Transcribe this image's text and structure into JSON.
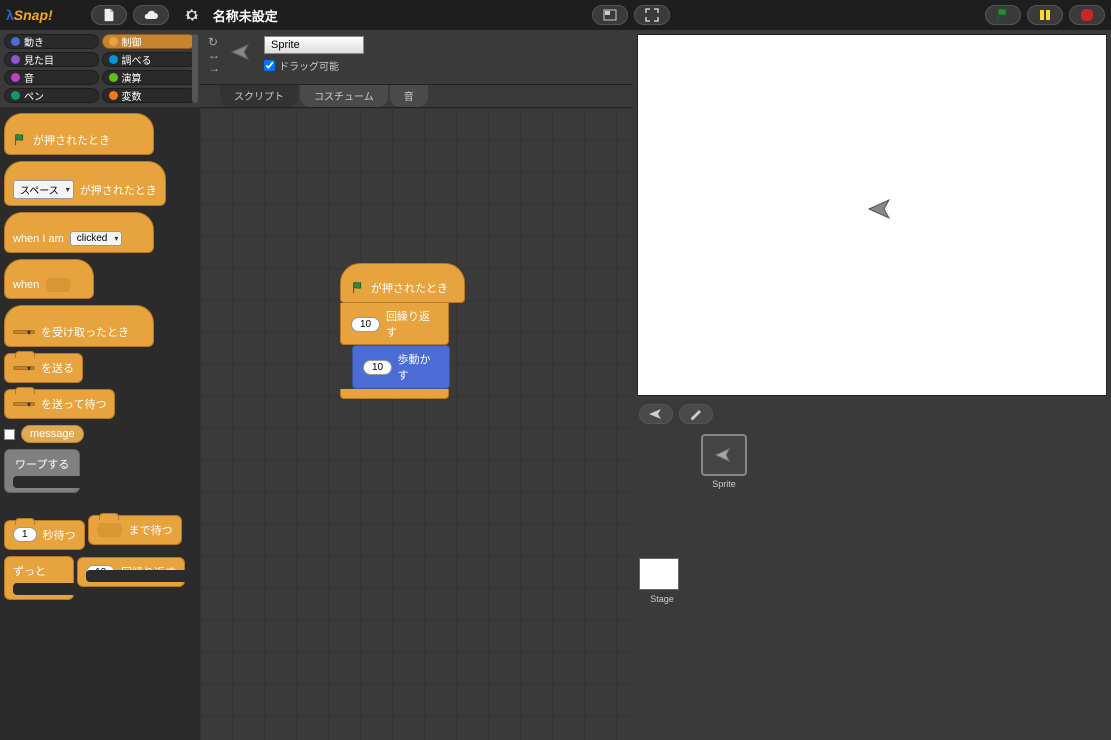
{
  "toolbar": {
    "logo_text": "Snap!",
    "project_name": "名称未設定"
  },
  "categories": {
    "motion": "動き",
    "control": "制御",
    "looks": "見た目",
    "sensing": "調べる",
    "sound": "音",
    "operators": "演算",
    "pen": "ペン",
    "variables": "変数"
  },
  "palette": {
    "when_flag": "が押されたとき",
    "when_key": "が押されたとき",
    "key_space": "スペース",
    "when_i_am": "when I am",
    "clicked": "clicked",
    "when": "when",
    "when_receive": "を受け取ったとき",
    "broadcast": "を送る",
    "broadcast_wait": "を送って待つ",
    "message": "message",
    "warp": "ワープする",
    "wait_secs": "秒待つ",
    "wait_until": "まで待つ",
    "forever": "ずっと",
    "repeat": "回繰り返す",
    "one": "1",
    "ten": "10"
  },
  "sprite_info": {
    "name": "Sprite",
    "draggable_label": "ドラッグ可能"
  },
  "tabs": {
    "scripts": "スクリプト",
    "costumes": "コスチューム",
    "sounds": "音"
  },
  "script": {
    "when_flag": "が押されたとき",
    "repeat_label": "回繰り返す",
    "repeat_value": "10",
    "move_label": "歩動かす",
    "move_value": "10"
  },
  "corral": {
    "sprite_label": "Sprite",
    "stage_label": "Stage"
  }
}
